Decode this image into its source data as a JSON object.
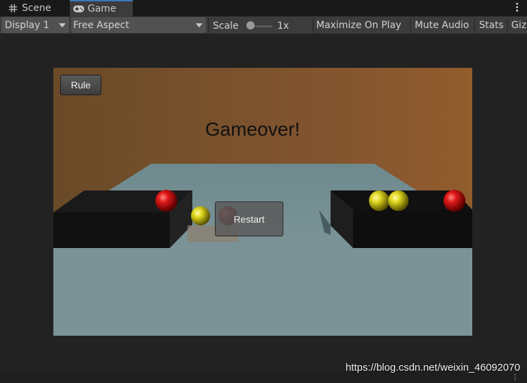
{
  "tabs": [
    {
      "label": "Scene",
      "icon": "grid-icon"
    },
    {
      "label": "Game",
      "icon": "gamepad-icon",
      "active": true
    }
  ],
  "toolbar": {
    "display": "Display 1",
    "aspect": "Free Aspect",
    "scale_label": "Scale",
    "scale_value": "1x",
    "maximize": "Maximize On Play",
    "mute": "Mute Audio",
    "stats": "Stats",
    "gizmos": "Giz"
  },
  "game": {
    "rule_button": "Rule",
    "status": "Gameover!",
    "restart_button": "Restart"
  },
  "watermark": "https://blog.csdn.net/weixin_46092070",
  "colors": {
    "tab_accent": "#3a79bb",
    "sky": "#845630",
    "ground": "#7b9396",
    "red_ball": "#c81414",
    "yellow_ball": "#d8d21a"
  }
}
